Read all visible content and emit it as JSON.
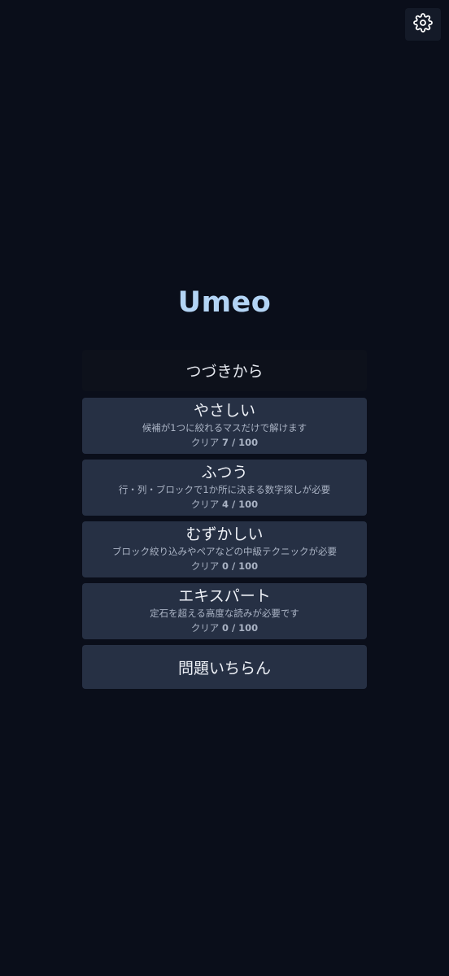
{
  "header": {
    "settings_icon": "gear-icon"
  },
  "app": {
    "title": "Umeo"
  },
  "menu": {
    "continue_label": "つづきから",
    "levels": [
      {
        "name": "やさしい",
        "description": "候補が1つに絞れるマスだけで解けます",
        "progress_label": "クリア",
        "progress_count": "7 / 100"
      },
      {
        "name": "ふつう",
        "description": "行・列・ブロックで1か所に決まる数字探しが必要",
        "progress_label": "クリア",
        "progress_count": "4 / 100"
      },
      {
        "name": "むずかしい",
        "description": "ブロック絞り込みやペアなどの中級テクニックが必要",
        "progress_label": "クリア",
        "progress_count": "0 / 100"
      },
      {
        "name": "エキスパート",
        "description": "定石を超える高度な読みが必要です",
        "progress_label": "クリア",
        "progress_count": "0 / 100"
      }
    ],
    "list_label": "問題いちらん"
  }
}
